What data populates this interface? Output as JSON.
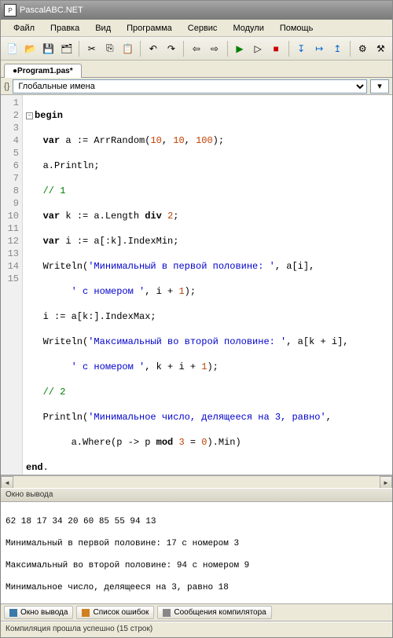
{
  "title": "PascalABC.NET",
  "menu": [
    "Файл",
    "Правка",
    "Вид",
    "Программа",
    "Сервис",
    "Модули",
    "Помощь"
  ],
  "tab": "●Program1.pas*",
  "scope": "Глобальные имена",
  "gutter": [
    "1",
    "2",
    "3",
    "4",
    "5",
    "6",
    "7",
    "8",
    "9",
    "10",
    "11",
    "12",
    "13",
    "14",
    "15"
  ],
  "code": {
    "l1a": "begin",
    "l2a": "   ",
    "l2kw": "var",
    "l2b": " a := ArrRandom(",
    "l2n1": "10",
    "l2c": ", ",
    "l2n2": "10",
    "l2d": ", ",
    "l2n3": "100",
    "l2e": ");",
    "l3": "   a.Println;",
    "l4a": "   ",
    "l4c": "// 1",
    "l5a": "   ",
    "l5kw": "var",
    "l5b": " k := a.Length ",
    "l5kw2": "div",
    "l5c": " ",
    "l5n": "2",
    "l5d": ";",
    "l6a": "   ",
    "l6kw": "var",
    "l6b": " i := a[:k].IndexMin;",
    "l7a": "   Writeln(",
    "l7s": "'Минимальный в первой половине: '",
    "l7b": ", a[i],",
    "l8a": "        ",
    "l8s": "' с номером '",
    "l8b": ", i + ",
    "l8n": "1",
    "l8c": ");",
    "l9": "   i := a[k:].IndexMax;",
    "l10a": "   Writeln(",
    "l10s": "'Максимальный во второй половине: '",
    "l10b": ", a[k + i],",
    "l11a": "        ",
    "l11s": "' с номером '",
    "l11b": ", k + i + ",
    "l11n": "1",
    "l11c": ");",
    "l12a": "   ",
    "l12c": "// 2",
    "l13a": "   Println(",
    "l13s": "'Минимальное число, делящееся на 3, равно'",
    "l13b": ",",
    "l14a": "        a.Where(p -> p ",
    "l14kw": "mod",
    "l14b": " ",
    "l14n1": "3",
    "l14c": " = ",
    "l14n2": "0",
    "l14d": ").Min)",
    "l15a": "end",
    "l15b": "."
  },
  "output_title": "Окно вывода",
  "output": {
    "l1": "62 18 17 34 20 60 85 55 94 13",
    "l2": "Минимальный в первой половине: 17 с номером 3",
    "l3": "Максимальный во второй половине: 94 с номером 9",
    "l4": "Минимальное число, делящееся на 3, равно 18"
  },
  "btabs": {
    "out": "Окно вывода",
    "err": "Список ошибок",
    "msg": "Сообщения компилятора"
  },
  "status": "Компиляция прошла успешно (15 строк)"
}
